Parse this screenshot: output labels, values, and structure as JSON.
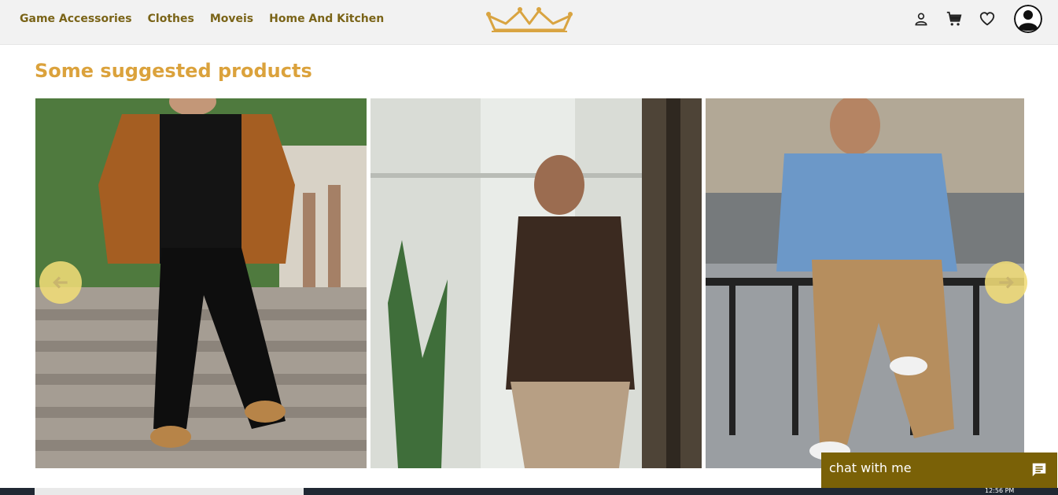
{
  "nav": {
    "links": [
      "Game Accessories",
      "Clothes",
      "Moveis",
      "Home And Kitchen"
    ],
    "icons": [
      "person-icon",
      "cart-icon",
      "heart-icon"
    ],
    "accent_color": "#7a6418"
  },
  "main": {
    "section_title": "Some suggested products",
    "title_color": "#dba23c",
    "products": [
      {
        "image": "man-brown-suede-jacket-black-jeans"
      },
      {
        "image": "man-brown-short-sleeve-shirt-leaning"
      },
      {
        "image": "man-denim-shirt-khaki-pants"
      }
    ]
  },
  "chat": {
    "label": "chat with me",
    "color": "#7a6107"
  },
  "taskbar": {
    "clock": "12:56 PM"
  }
}
